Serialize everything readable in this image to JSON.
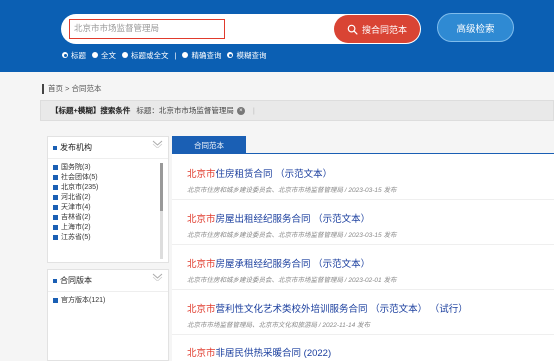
{
  "search": {
    "value": "北京市市场监督管理局",
    "button_label": "搜合同范本",
    "advanced_label": "高级检索"
  },
  "options": {
    "title": "标题",
    "fulltext": "全文",
    "title_or_fulltext": "标题或全文",
    "separator": "|",
    "exact": "精确查询",
    "fuzzy": "模糊查询"
  },
  "breadcrumb": "首页 > 合同范本",
  "condition": {
    "label": "【标题+模糊】搜索条件",
    "term": "标题：北京市市场监督管理局",
    "separator": "|"
  },
  "sidebar": {
    "issuer": {
      "title": "发布机构",
      "items": [
        {
          "label": "国务院(3)"
        },
        {
          "label": "社会团体(5)"
        },
        {
          "label": "北京市(235)"
        },
        {
          "label": "河北省(2)"
        },
        {
          "label": "天津市(4)"
        },
        {
          "label": "吉林省(2)"
        },
        {
          "label": "上海市(2)"
        },
        {
          "label": "江苏省(5)"
        }
      ]
    },
    "version": {
      "title": "合同版本",
      "items": [
        {
          "label": "官方版本(121)"
        }
      ]
    }
  },
  "tab": "合同范本",
  "results": [
    {
      "hl": "北京市",
      "rest": "住房租赁合同 （示范文本）",
      "meta": "北京市住房和城乡建设委员会、北京市市场监督管理局 / 2023-03-15 发布"
    },
    {
      "hl": "北京市",
      "rest": "房屋出租经纪服务合同 （示范文本）",
      "meta": "北京市住房和城乡建设委员会、北京市市场监督管理局 / 2023-03-15 发布"
    },
    {
      "hl": "北京市",
      "rest": "房屋承租经纪服务合同 （示范文本）",
      "meta": "北京市住房和城乡建设委员会、北京市市场监督管理局 / 2023-02-01 发布"
    },
    {
      "hl": "北京市",
      "rest": "营利性文化艺术类校外培训服务合同 （示范文本） （试行）",
      "meta": "北京市市场监督管理局、北京市文化和旅游局 / 2022-11-14 发布"
    },
    {
      "hl": "北京市",
      "rest": "非居民供热采暖合同 (2022)",
      "meta": ""
    }
  ],
  "colors": {
    "header": "#0b5fb3",
    "accent_red": "#d94434",
    "link_blue": "#1a3e9e",
    "highlight_red": "#e03a2c"
  }
}
